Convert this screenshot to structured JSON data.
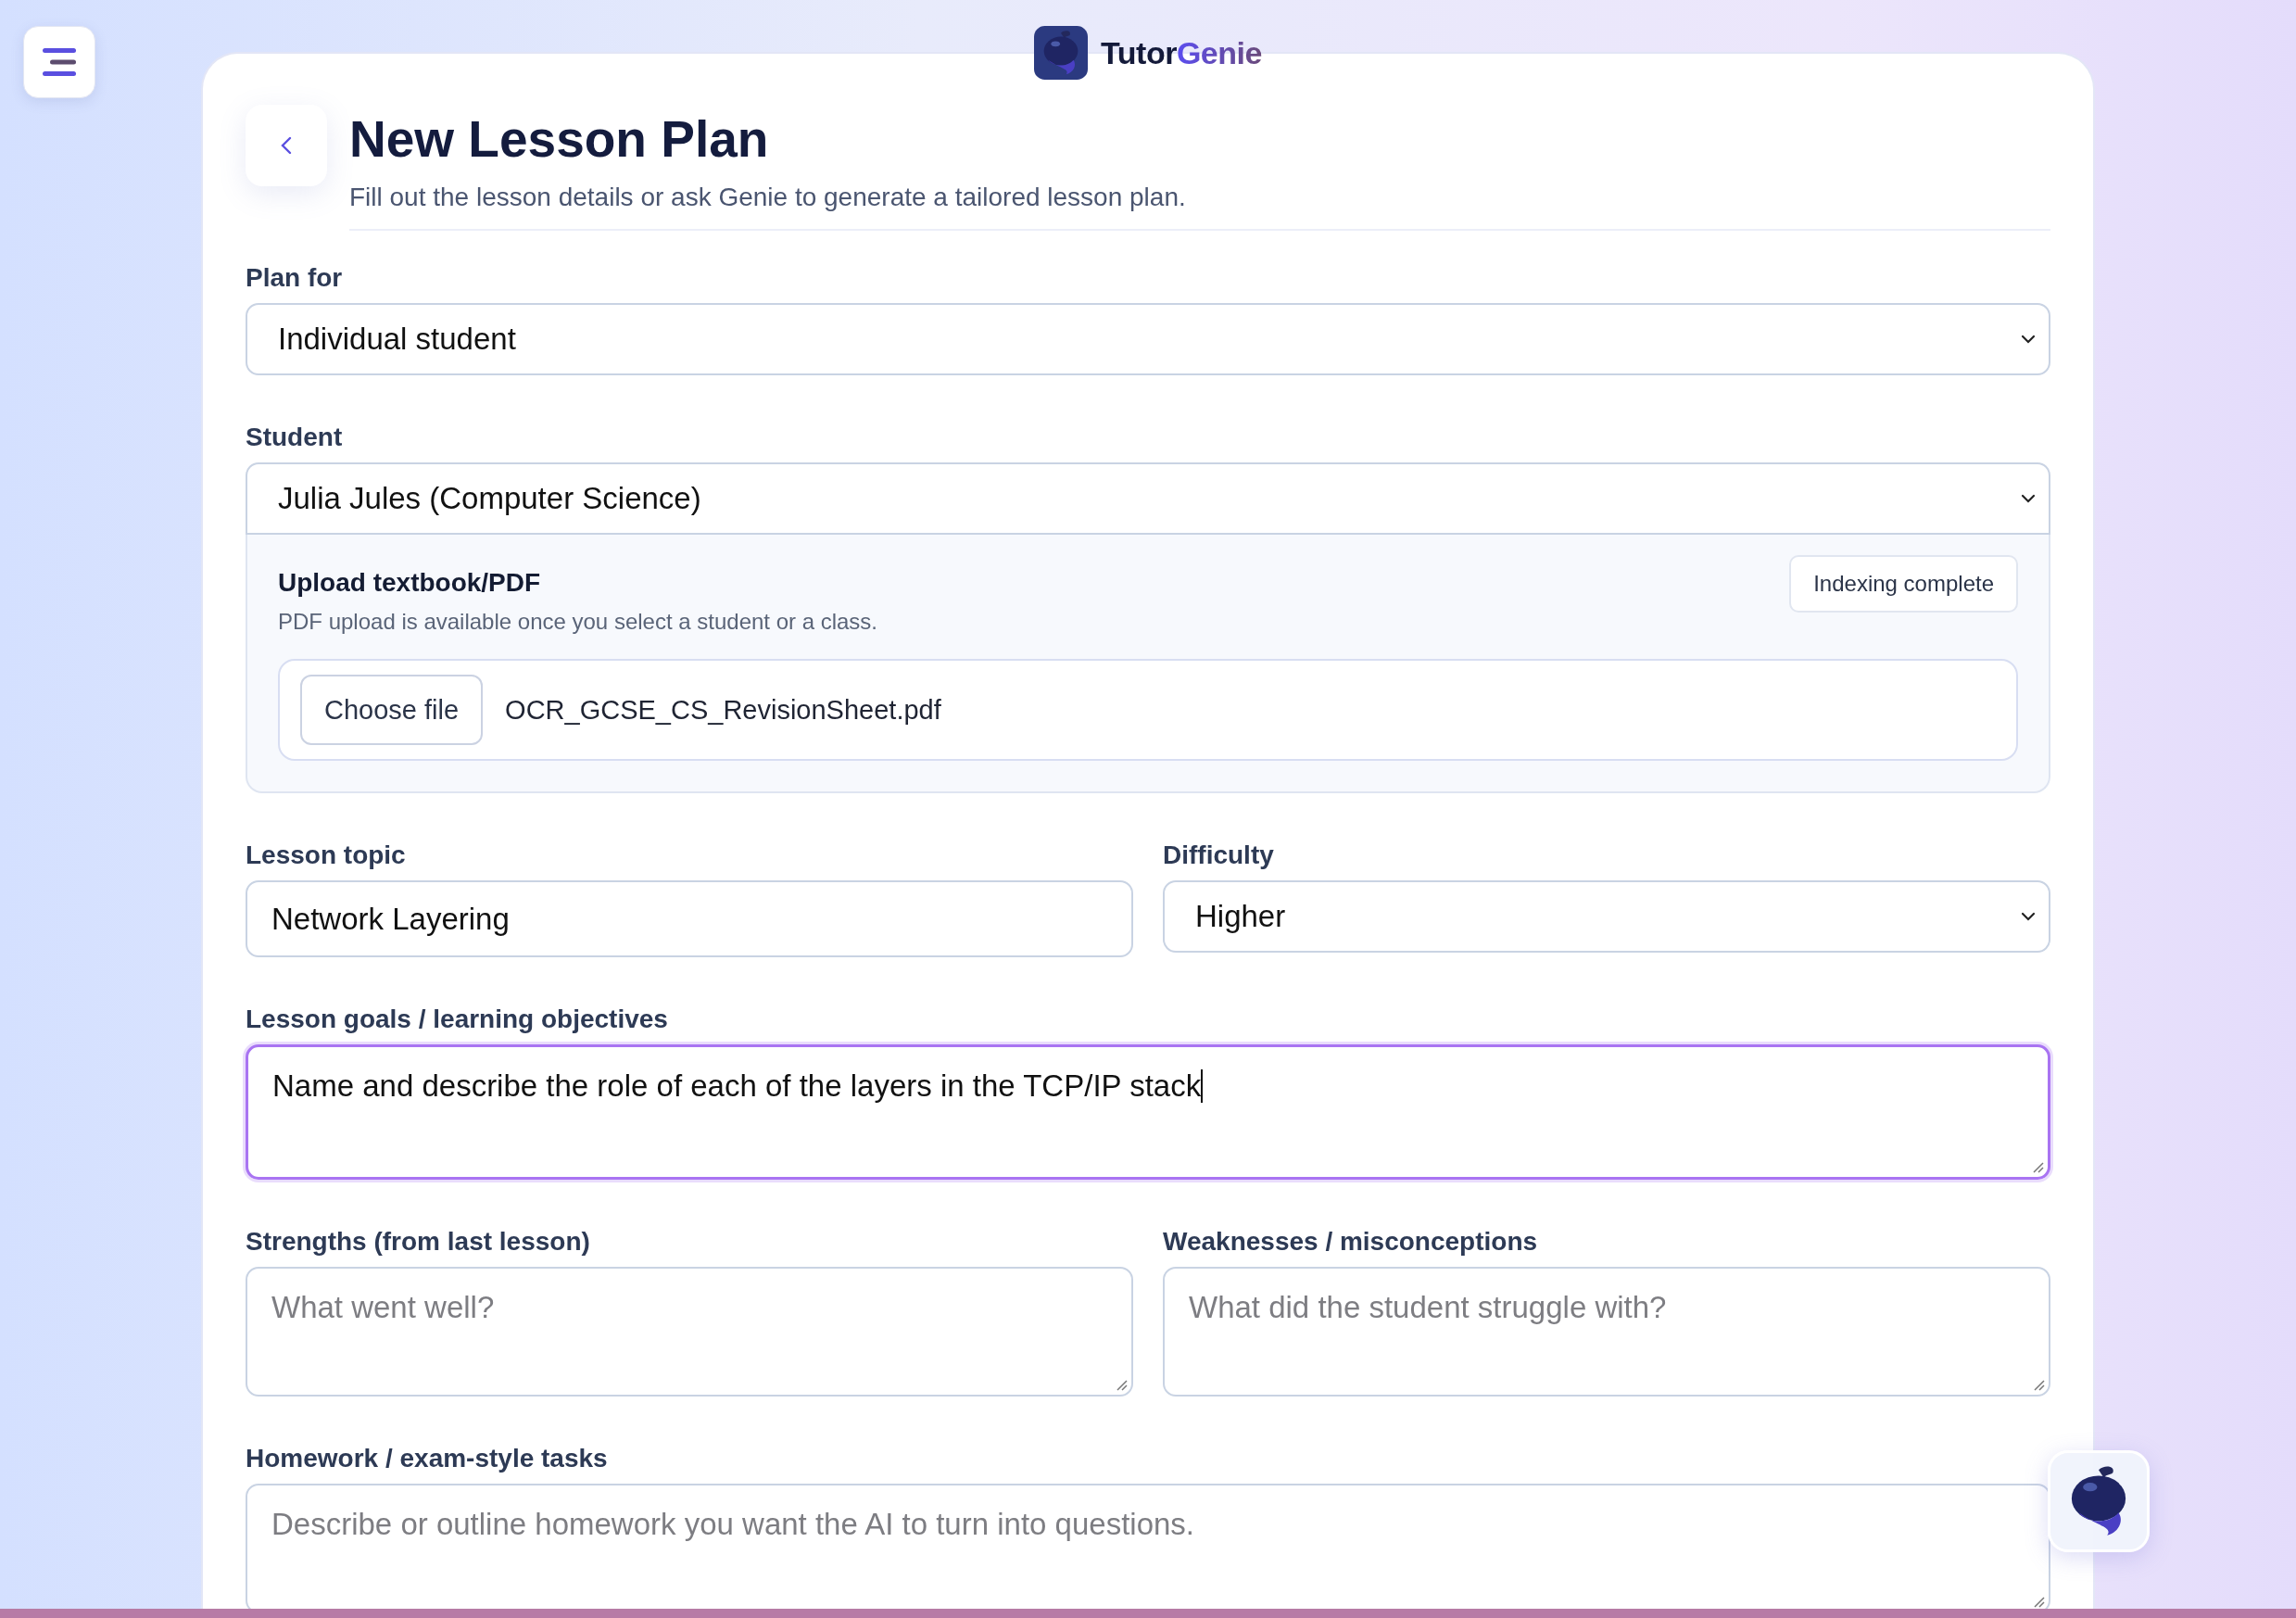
{
  "brand": {
    "name_part1": "Tutor",
    "name_part2": "Genie"
  },
  "page": {
    "title": "New Lesson Plan",
    "subtitle": "Fill out the lesson details or ask Genie to generate a tailored lesson plan."
  },
  "rows": [
    {
      "fields": [
        {
          "kind": "select",
          "label": "Plan for",
          "value": "Individual student"
        }
      ]
    },
    {
      "fields": [
        {
          "kind": "select",
          "label": "Student",
          "value": "Julia Jules (Computer Science)",
          "upload": {
            "title": "Upload textbook/PDF",
            "note": "PDF upload is available once you select a student or a class.",
            "status": "Indexing complete",
            "button": "Choose file",
            "file": "OCR_GCSE_CS_RevisionSheet.pdf"
          }
        }
      ]
    },
    {
      "fields": [
        {
          "kind": "text",
          "label": "Lesson topic",
          "value": "Network Layering"
        },
        {
          "kind": "select",
          "label": "Difficulty",
          "value": "Higher"
        }
      ]
    },
    {
      "fields": [
        {
          "kind": "textarea",
          "label": "Lesson goals / learning objectives",
          "value": "Name and describe the role of each of the layers in the TCP/IP stack",
          "focused": true
        }
      ]
    },
    {
      "fields": [
        {
          "kind": "textarea",
          "label": "Strengths (from last lesson)",
          "placeholder": "What went well?",
          "focused": false
        },
        {
          "kind": "textarea",
          "label": "Weaknesses / misconceptions",
          "placeholder": "What did the student struggle with?",
          "focused": false
        }
      ]
    },
    {
      "fields": [
        {
          "kind": "textarea",
          "label": "Homework / exam-style tasks",
          "placeholder": "Describe or outline homework you want the AI to turn into questions.",
          "focused": false
        }
      ]
    }
  ]
}
